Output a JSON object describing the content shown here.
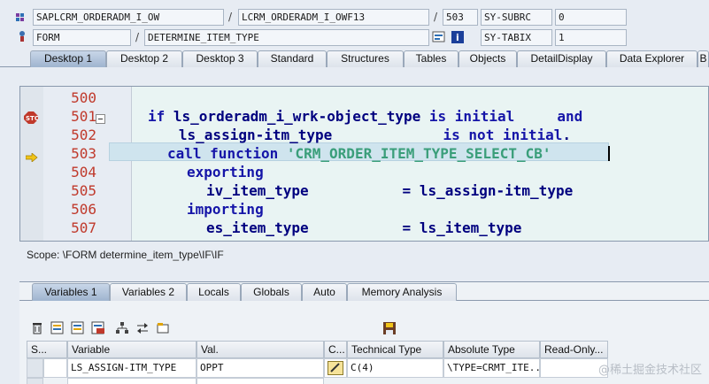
{
  "header": {
    "row1": {
      "program": "SAPLCRM_ORDERADM_I_OW",
      "include": "LCRM_ORDERADM_I_OWF13",
      "line": "503",
      "sy_label": "SY-SUBRC",
      "sy_value": "0"
    },
    "row2": {
      "type": "FORM",
      "name": "DETERMINE_ITEM_TYPE",
      "sy_label": "SY-TABIX",
      "sy_value": "1"
    },
    "sep": "/"
  },
  "desktop_tabs": [
    "Desktop 1",
    "Desktop 2",
    "Desktop 3",
    "Standard",
    "Structures",
    "Tables",
    "Objects",
    "DetailDisplay",
    "Data Explorer",
    "B"
  ],
  "code": {
    "lines": [
      {
        "num": "500",
        "text": ""
      },
      {
        "num": "501",
        "text": "if ls_orderadm_i_wrk-object_type is initial     and"
      },
      {
        "num": "502",
        "text": "   ls_assign-itm_type             is not initial."
      },
      {
        "num": "503",
        "text": "call function 'CRM_ORDER_ITEM_TYPE_SELECT_CB'"
      },
      {
        "num": "504",
        "text": "exporting"
      },
      {
        "num": "505",
        "text": "iv_item_type           = ls_assign-itm_type"
      },
      {
        "num": "506",
        "text": "importing"
      },
      {
        "num": "507",
        "text": "es_item_type           = ls_item_type"
      }
    ]
  },
  "scope": "Scope: \\FORM determine_item_type\\IF\\IF",
  "var_tabs": [
    "Variables 1",
    "Variables 2",
    "Locals",
    "Globals",
    "Auto",
    "Memory Analysis"
  ],
  "grid": {
    "headers": [
      "S...",
      "Variable",
      "Val.",
      "C...",
      "Technical Type",
      "Absolute Type",
      "Read-Only..."
    ],
    "row": {
      "variable": "LS_ASSIGN-ITM_TYPE",
      "value": "OPPT",
      "tech_type": "C(4)",
      "abs_type": "\\TYPE=CRMT_ITE..."
    }
  },
  "watermark": "@稀土掘金技术社区",
  "colors": {
    "accent": "#9fb4cf",
    "line_numbers": "#c0392b",
    "keyword": "#1515a8",
    "string": "#3a9e7a",
    "code_bg": "#e9f4f3"
  }
}
